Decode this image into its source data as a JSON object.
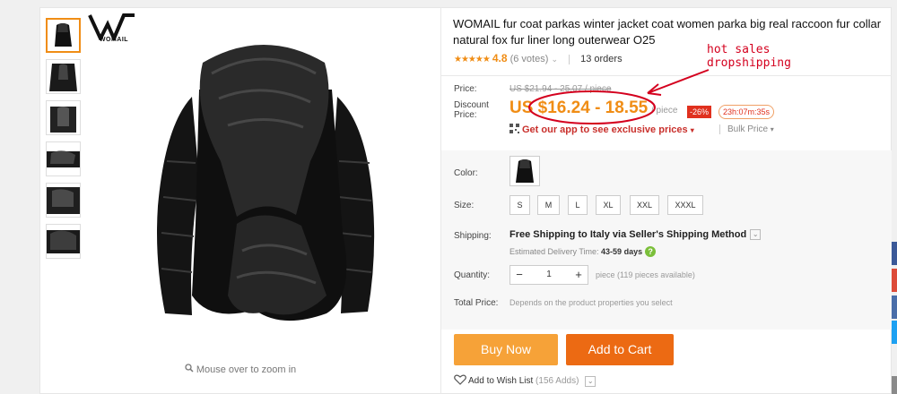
{
  "product": {
    "title": "WOMAIL fur coat parkas winter jacket coat women parka big real raccoon fur collar natural fox fur liner long outerwear O25",
    "rating_value": "4.8",
    "votes": "(6 votes)",
    "orders": "13 orders"
  },
  "brand": {
    "logo_letter": "W",
    "logo_text": "WOMAIL"
  },
  "gallery": {
    "zoom_hint": "Mouse over to zoom in",
    "thumbnail_count": 6
  },
  "price": {
    "label": "Price:",
    "original": "US $21.94 - 25.07 / piece",
    "discount_label_line1": "Discount",
    "discount_label_line2": "Price:",
    "discount": "US $16.24 - 18.55",
    "per_unit": "/ piece",
    "discount_percent": "-26%",
    "countdown": "23h:07m:35s",
    "app_promo": "Get our app to see exclusive prices",
    "bulk_price": "Bulk Price"
  },
  "options": {
    "color_label": "Color:",
    "size_label": "Size:",
    "sizes": [
      "S",
      "M",
      "L",
      "XL",
      "XXL",
      "XXXL"
    ]
  },
  "shipping": {
    "label": "Shipping:",
    "method": "Free Shipping to Italy via Seller's Shipping Method",
    "estimate_label": "Estimated Delivery Time:",
    "estimate_value": "43-59 days"
  },
  "quantity": {
    "label": "Quantity:",
    "value": "1",
    "minus": "−",
    "plus": "+",
    "available": "piece (119 pieces available)"
  },
  "total": {
    "label": "Total Price:",
    "note": "Depends on the product properties you select"
  },
  "actions": {
    "buy_now": "Buy Now",
    "add_to_cart": "Add to Cart",
    "wishlist": "Add to Wish List",
    "wishlist_count": "(156 Adds)"
  },
  "annotation": {
    "line1": "hot sales",
    "line2": "dropshipping",
    "color": "#d4001e"
  },
  "colors": {
    "accent": "#f08d15",
    "buy_button": "#f6a238",
    "cart_button": "#ec6a13",
    "sale_red": "#e0301e",
    "social": [
      "#3b5998",
      "#dd4b39",
      "#4a6ea9",
      "#1da1f2",
      "#8a8a8a"
    ]
  }
}
